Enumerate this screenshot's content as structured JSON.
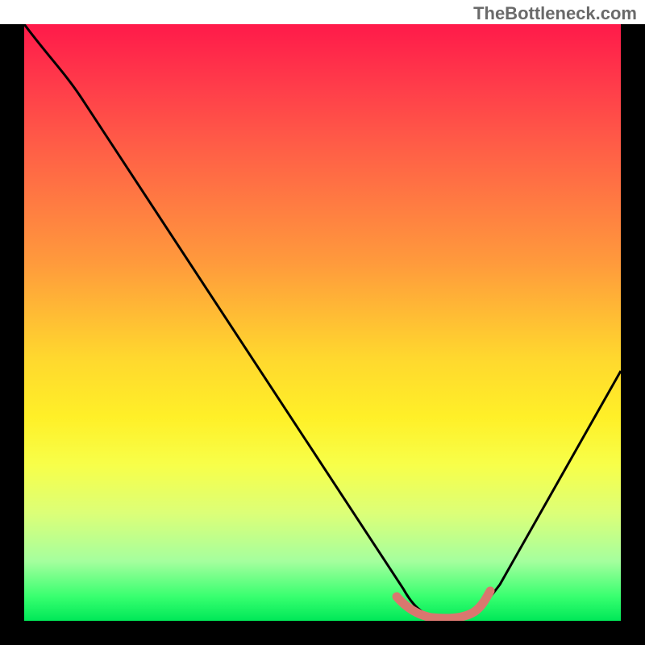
{
  "watermark": "TheBottleneck.com",
  "chart_data": {
    "type": "line",
    "title": "",
    "xlabel": "",
    "ylabel": "",
    "xlim": [
      0,
      100
    ],
    "ylim": [
      0,
      100
    ],
    "series": [
      {
        "name": "bottleneck-curve",
        "x": [
          0,
          8,
          20,
          35,
          50,
          60,
          63,
          68,
          73,
          76,
          82,
          90,
          100
        ],
        "y": [
          100,
          93,
          78,
          58,
          38,
          18,
          6,
          1,
          1,
          2,
          10,
          24,
          44
        ],
        "color": "#000000"
      },
      {
        "name": "optimal-zone",
        "x": [
          62,
          64,
          68,
          72,
          75,
          77
        ],
        "y": [
          5,
          2,
          1,
          1,
          2,
          5
        ],
        "color": "#d9776f"
      }
    ],
    "gradient_background": {
      "type": "vertical",
      "stops": [
        {
          "pos": 0.0,
          "color": "#ff1a4a"
        },
        {
          "pos": 0.5,
          "color": "#ffb935"
        },
        {
          "pos": 0.75,
          "color": "#f7ff4a"
        },
        {
          "pos": 1.0,
          "color": "#00e858"
        }
      ]
    }
  }
}
